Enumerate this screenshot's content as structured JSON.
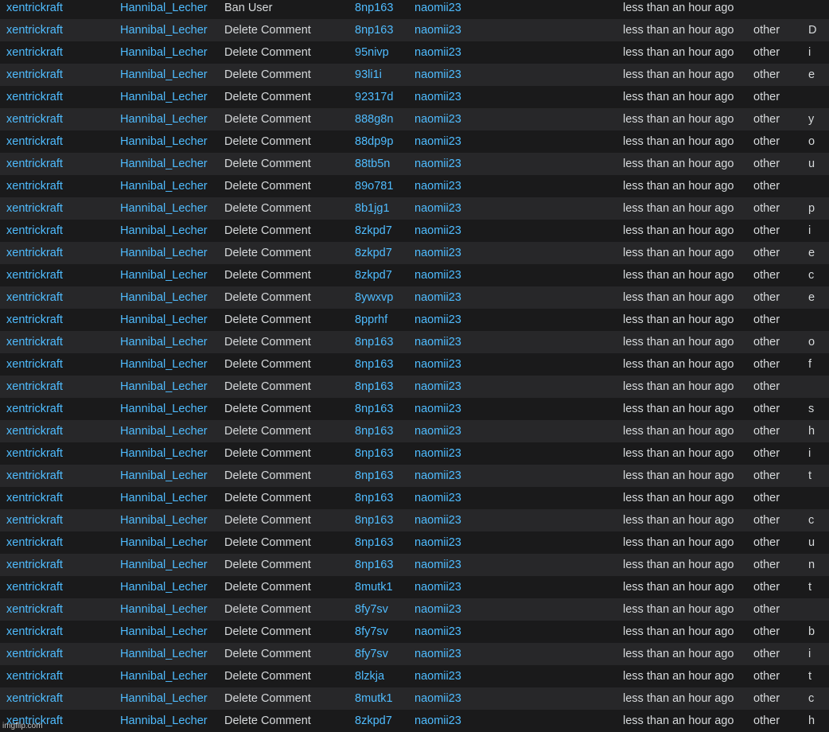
{
  "rows": [
    {
      "moderator": "xentrickraft",
      "author": "Hannibal_Lecher",
      "action": "Ban User",
      "target": "8np163",
      "target_user": "naomii23",
      "time": "less than an hour ago",
      "reason": "",
      "letter": ""
    },
    {
      "moderator": "xentrickraft",
      "author": "Hannibal_Lecher",
      "action": "Delete Comment",
      "target": "8np163",
      "target_user": "naomii23",
      "time": "less than an hour ago",
      "reason": "other",
      "letter": "D"
    },
    {
      "moderator": "xentrickraft",
      "author": "Hannibal_Lecher",
      "action": "Delete Comment",
      "target": "95nivp",
      "target_user": "naomii23",
      "time": "less than an hour ago",
      "reason": "other",
      "letter": "i"
    },
    {
      "moderator": "xentrickraft",
      "author": "Hannibal_Lecher",
      "action": "Delete Comment",
      "target": "93li1i",
      "target_user": "naomii23",
      "time": "less than an hour ago",
      "reason": "other",
      "letter": "e"
    },
    {
      "moderator": "xentrickraft",
      "author": "Hannibal_Lecher",
      "action": "Delete Comment",
      "target": "92317d",
      "target_user": "naomii23",
      "time": "less than an hour ago",
      "reason": "other",
      "letter": ""
    },
    {
      "moderator": "xentrickraft",
      "author": "Hannibal_Lecher",
      "action": "Delete Comment",
      "target": "888g8n",
      "target_user": "naomii23",
      "time": "less than an hour ago",
      "reason": "other",
      "letter": "y"
    },
    {
      "moderator": "xentrickraft",
      "author": "Hannibal_Lecher",
      "action": "Delete Comment",
      "target": "88dp9p",
      "target_user": "naomii23",
      "time": "less than an hour ago",
      "reason": "other",
      "letter": "o"
    },
    {
      "moderator": "xentrickraft",
      "author": "Hannibal_Lecher",
      "action": "Delete Comment",
      "target": "88tb5n",
      "target_user": "naomii23",
      "time": "less than an hour ago",
      "reason": "other",
      "letter": "u"
    },
    {
      "moderator": "xentrickraft",
      "author": "Hannibal_Lecher",
      "action": "Delete Comment",
      "target": "89o781",
      "target_user": "naomii23",
      "time": "less than an hour ago",
      "reason": "other",
      "letter": ""
    },
    {
      "moderator": "xentrickraft",
      "author": "Hannibal_Lecher",
      "action": "Delete Comment",
      "target": "8b1jg1",
      "target_user": "naomii23",
      "time": "less than an hour ago",
      "reason": "other",
      "letter": "p"
    },
    {
      "moderator": "xentrickraft",
      "author": "Hannibal_Lecher",
      "action": "Delete Comment",
      "target": "8zkpd7",
      "target_user": "naomii23",
      "time": "less than an hour ago",
      "reason": "other",
      "letter": "i"
    },
    {
      "moderator": "xentrickraft",
      "author": "Hannibal_Lecher",
      "action": "Delete Comment",
      "target": "8zkpd7",
      "target_user": "naomii23",
      "time": "less than an hour ago",
      "reason": "other",
      "letter": "e"
    },
    {
      "moderator": "xentrickraft",
      "author": "Hannibal_Lecher",
      "action": "Delete Comment",
      "target": "8zkpd7",
      "target_user": "naomii23",
      "time": "less than an hour ago",
      "reason": "other",
      "letter": "c"
    },
    {
      "moderator": "xentrickraft",
      "author": "Hannibal_Lecher",
      "action": "Delete Comment",
      "target": "8ywxvp",
      "target_user": "naomii23",
      "time": "less than an hour ago",
      "reason": "other",
      "letter": "e"
    },
    {
      "moderator": "xentrickraft",
      "author": "Hannibal_Lecher",
      "action": "Delete Comment",
      "target": "8pprhf",
      "target_user": "naomii23",
      "time": "less than an hour ago",
      "reason": "other",
      "letter": ""
    },
    {
      "moderator": "xentrickraft",
      "author": "Hannibal_Lecher",
      "action": "Delete Comment",
      "target": "8np163",
      "target_user": "naomii23",
      "time": "less than an hour ago",
      "reason": "other",
      "letter": "o"
    },
    {
      "moderator": "xentrickraft",
      "author": "Hannibal_Lecher",
      "action": "Delete Comment",
      "target": "8np163",
      "target_user": "naomii23",
      "time": "less than an hour ago",
      "reason": "other",
      "letter": "f"
    },
    {
      "moderator": "xentrickraft",
      "author": "Hannibal_Lecher",
      "action": "Delete Comment",
      "target": "8np163",
      "target_user": "naomii23",
      "time": "less than an hour ago",
      "reason": "other",
      "letter": ""
    },
    {
      "moderator": "xentrickraft",
      "author": "Hannibal_Lecher",
      "action": "Delete Comment",
      "target": "8np163",
      "target_user": "naomii23",
      "time": "less than an hour ago",
      "reason": "other",
      "letter": "s"
    },
    {
      "moderator": "xentrickraft",
      "author": "Hannibal_Lecher",
      "action": "Delete Comment",
      "target": "8np163",
      "target_user": "naomii23",
      "time": "less than an hour ago",
      "reason": "other",
      "letter": "h"
    },
    {
      "moderator": "xentrickraft",
      "author": "Hannibal_Lecher",
      "action": "Delete Comment",
      "target": "8np163",
      "target_user": "naomii23",
      "time": "less than an hour ago",
      "reason": "other",
      "letter": "i"
    },
    {
      "moderator": "xentrickraft",
      "author": "Hannibal_Lecher",
      "action": "Delete Comment",
      "target": "8np163",
      "target_user": "naomii23",
      "time": "less than an hour ago",
      "reason": "other",
      "letter": "t"
    },
    {
      "moderator": "xentrickraft",
      "author": "Hannibal_Lecher",
      "action": "Delete Comment",
      "target": "8np163",
      "target_user": "naomii23",
      "time": "less than an hour ago",
      "reason": "other",
      "letter": ""
    },
    {
      "moderator": "xentrickraft",
      "author": "Hannibal_Lecher",
      "action": "Delete Comment",
      "target": "8np163",
      "target_user": "naomii23",
      "time": "less than an hour ago",
      "reason": "other",
      "letter": "c"
    },
    {
      "moderator": "xentrickraft",
      "author": "Hannibal_Lecher",
      "action": "Delete Comment",
      "target": "8np163",
      "target_user": "naomii23",
      "time": "less than an hour ago",
      "reason": "other",
      "letter": "u"
    },
    {
      "moderator": "xentrickraft",
      "author": "Hannibal_Lecher",
      "action": "Delete Comment",
      "target": "8np163",
      "target_user": "naomii23",
      "time": "less than an hour ago",
      "reason": "other",
      "letter": "n"
    },
    {
      "moderator": "xentrickraft",
      "author": "Hannibal_Lecher",
      "action": "Delete Comment",
      "target": "8mutk1",
      "target_user": "naomii23",
      "time": "less than an hour ago",
      "reason": "other",
      "letter": "t"
    },
    {
      "moderator": "xentrickraft",
      "author": "Hannibal_Lecher",
      "action": "Delete Comment",
      "target": "8fy7sv",
      "target_user": "naomii23",
      "time": "less than an hour ago",
      "reason": "other",
      "letter": ""
    },
    {
      "moderator": "xentrickraft",
      "author": "Hannibal_Lecher",
      "action": "Delete Comment",
      "target": "8fy7sv",
      "target_user": "naomii23",
      "time": "less than an hour ago",
      "reason": "other",
      "letter": "b"
    },
    {
      "moderator": "xentrickraft",
      "author": "Hannibal_Lecher",
      "action": "Delete Comment",
      "target": "8fy7sv",
      "target_user": "naomii23",
      "time": "less than an hour ago",
      "reason": "other",
      "letter": "i"
    },
    {
      "moderator": "xentrickraft",
      "author": "Hannibal_Lecher",
      "action": "Delete Comment",
      "target": "8lzkja",
      "target_user": "naomii23",
      "time": "less than an hour ago",
      "reason": "other",
      "letter": "t"
    },
    {
      "moderator": "xentrickraft",
      "author": "Hannibal_Lecher",
      "action": "Delete Comment",
      "target": "8mutk1",
      "target_user": "naomii23",
      "time": "less than an hour ago",
      "reason": "other",
      "letter": "c"
    },
    {
      "moderator": "xentrickraft",
      "author": "Hannibal_Lecher",
      "action": "Delete Comment",
      "target": "8zkpd7",
      "target_user": "naomii23",
      "time": "less than an hour ago",
      "reason": "other",
      "letter": "h"
    }
  ],
  "watermark": "imgflip.com",
  "colors": {
    "link": "#4fbcff",
    "text": "#d7dadc",
    "row_dark": "#1a1a1b",
    "row_light": "#272729"
  }
}
